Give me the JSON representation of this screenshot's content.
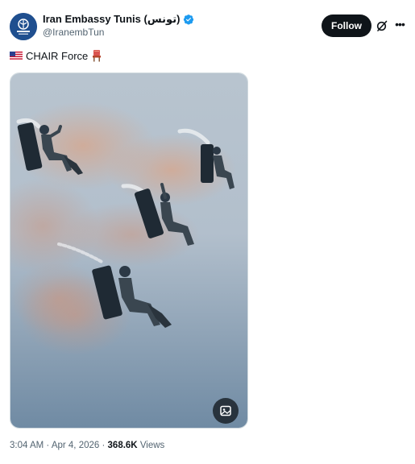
{
  "account": {
    "display_name": "Iran Embassy Tunis (تونس)",
    "handle": "@IranembTun",
    "verified": true,
    "avatar_color": "#1f4f8f"
  },
  "actions": {
    "follow_label": "Follow",
    "grok_icon": "grok-icon",
    "more_icon": "more-icon"
  },
  "tweet": {
    "flag_icon": "us-flag-emoji",
    "text": "CHAIR Force",
    "chair_icon": "chair-emoji"
  },
  "media": {
    "alt_icon": "image-edit-icon"
  },
  "meta": {
    "time": "3:04 AM",
    "separator": "·",
    "date": "Apr 4, 2026",
    "views_count": "368.6K",
    "views_label": "Views"
  },
  "colors": {
    "text": "#0f1419",
    "secondary": "#536471",
    "verified": "#1d9bf0",
    "button": "#0f1419"
  }
}
